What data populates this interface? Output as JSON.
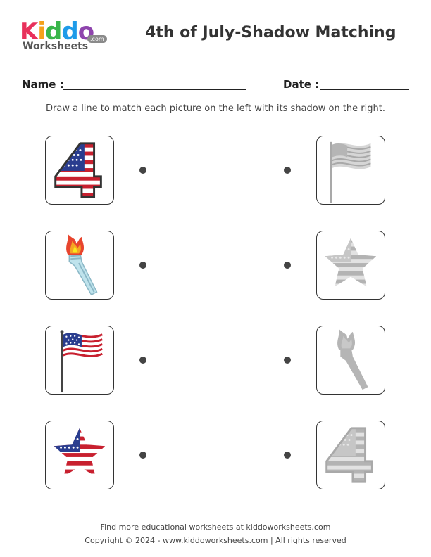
{
  "logo": {
    "kiddo_letters": [
      {
        "ch": "K",
        "color": "#e8315b"
      },
      {
        "ch": "i",
        "color": "#f4a11a"
      },
      {
        "ch": "d",
        "color": "#39b54a"
      },
      {
        "ch": "d",
        "color": "#1e9be9"
      },
      {
        "ch": "o",
        "color": "#8e44ad"
      }
    ],
    "worksheets": "Worksheets",
    "com": ".com"
  },
  "title": "4th of July-Shadow Matching",
  "fields": {
    "name_label": "Name :",
    "date_label": "Date :"
  },
  "instruction": "Draw a line to match each picture on the left with its shadow on the right.",
  "left_pictures": [
    "number-4-flag-icon",
    "torch-icon",
    "waving-flag-icon",
    "flag-star-icon"
  ],
  "right_shadows": [
    "waving-flag-shadow-icon",
    "flag-star-shadow-icon",
    "torch-shadow-icon",
    "number-4-shadow-icon"
  ],
  "colors": {
    "red": "#c8202f",
    "blue": "#2a3d8f",
    "shadow": "#bdbdbd",
    "shadow_dark": "#a9a9a9"
  },
  "footer": {
    "line1": "Find more educational worksheets at kiddoworksheets.com",
    "line2": "Copyright © 2024 - www.kiddoworksheets.com  |  All rights reserved"
  }
}
